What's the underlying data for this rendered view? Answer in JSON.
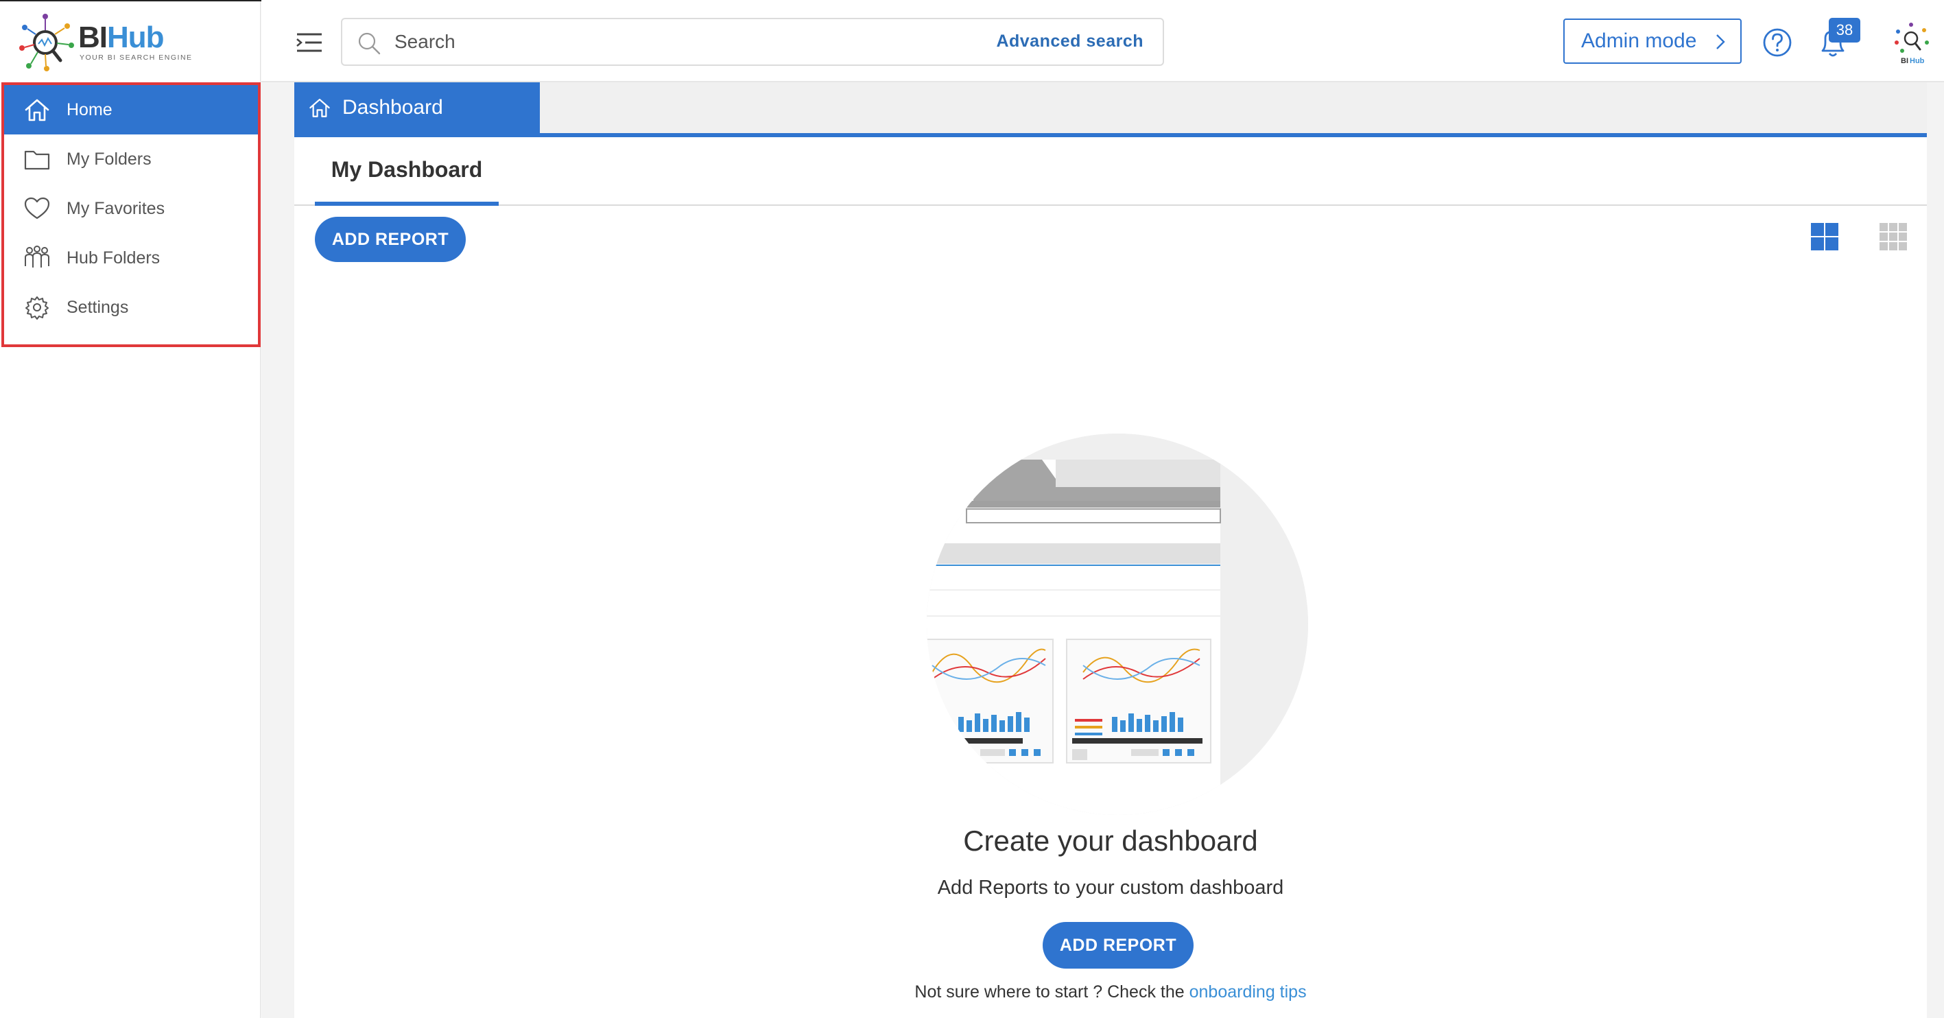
{
  "app": {
    "logo_title_bi": "BI",
    "logo_title_hub": "Hub",
    "logo_tagline": "YOUR BI SEARCH ENGINE",
    "brand_color": "#2f74cf",
    "highlight_color": "#e0383a"
  },
  "sidebar": {
    "items": [
      {
        "label": "Home",
        "icon": "home-icon",
        "active": true
      },
      {
        "label": "My Folders",
        "icon": "folder-icon",
        "active": false
      },
      {
        "label": "My Favorites",
        "icon": "heart-icon",
        "active": false
      },
      {
        "label": "Hub Folders",
        "icon": "users-group-icon",
        "active": false
      },
      {
        "label": "Settings",
        "icon": "gear-icon",
        "active": false
      }
    ]
  },
  "header": {
    "search_placeholder": "Search",
    "advanced_search": "Advanced search",
    "admin_mode": "Admin mode",
    "notification_count": "38"
  },
  "main": {
    "tab_label": "Dashboard",
    "subtab_label": "My Dashboard",
    "add_report_label": "ADD REPORT",
    "empty_title": "Create your dashboard",
    "empty_subtitle": "Add Reports to your custom dashboard",
    "add_report_center_label": "ADD REPORT",
    "tips_prefix": "Not sure where to start ? Check the",
    "tips_link": "onboarding tips"
  }
}
